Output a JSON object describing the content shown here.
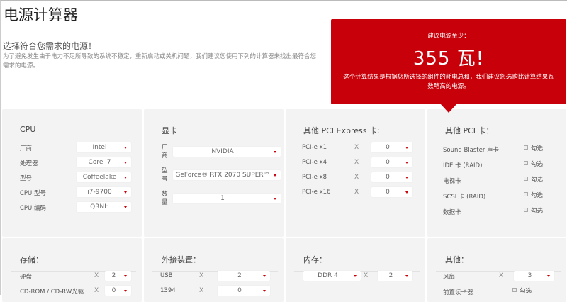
{
  "header": {
    "title": "电源计算器",
    "subtitle": "选择符合您需求的电源！",
    "description": "为了避免发生由于电力不足所导致的系统不稳定，重新启动或关机问题，我们建议您使用下列的计算器来找出最符合您需求的电源。"
  },
  "result": {
    "label": "建议电源至少：",
    "value": "355 瓦!",
    "note": "这个计算结果是根据您所选择的组件的耗电总和，我们建议您选购比计算结果瓦数略高的电源。",
    "color": "#c8000a"
  },
  "cpu": {
    "title": "CPU",
    "rows": [
      {
        "label": "厂商",
        "value": "Intel"
      },
      {
        "label": "处理器",
        "value": "Core i7"
      },
      {
        "label": "型号",
        "value": "Coffeelake"
      },
      {
        "label": "CPU 型号",
        "value": "i7-9700"
      },
      {
        "label": "CPU 编码",
        "value": "QRNH"
      }
    ]
  },
  "gpu": {
    "title": "显卡",
    "rows": [
      {
        "label": "厂商",
        "value": "NVIDIA"
      },
      {
        "label": "型号",
        "value": "GeForce® RTX 2070 SUPER™"
      },
      {
        "label": "数量",
        "value": "1"
      }
    ]
  },
  "pcie": {
    "title": "其他 PCI Express 卡:",
    "x": "X",
    "rows": [
      {
        "label": "PCI-e x1",
        "value": "0"
      },
      {
        "label": "PCI-e x4",
        "value": "0"
      },
      {
        "label": "PCI-e x8",
        "value": "0"
      },
      {
        "label": "PCI-e x16",
        "value": "0"
      }
    ]
  },
  "pci": {
    "title": "其他 PCI 卡：",
    "check_label": "勾选",
    "rows": [
      {
        "label": "Sound Blaster 声卡"
      },
      {
        "label": "IDE 卡 (RAID)"
      },
      {
        "label": "电视卡"
      },
      {
        "label": "SCSI 卡 (RAID)"
      },
      {
        "label": "数据卡"
      }
    ]
  },
  "storage": {
    "title": "存储：",
    "x": "X",
    "rows": [
      {
        "label": "硬盘",
        "value": "2"
      },
      {
        "label": "CD-ROM / CD-RW光驱",
        "value": "0"
      }
    ]
  },
  "external": {
    "title": "外接装置：",
    "x": "X",
    "rows": [
      {
        "label": "USB",
        "value": "2"
      },
      {
        "label": "1394",
        "value": "0"
      }
    ]
  },
  "memory": {
    "title": "内存：",
    "x": "X",
    "type": "DDR 4",
    "count": "2"
  },
  "other": {
    "title": "其他：",
    "x": "X",
    "fan_label": "风扇",
    "fan_value": "3",
    "reader_label": "前置读卡器",
    "check_label": "勾选"
  }
}
